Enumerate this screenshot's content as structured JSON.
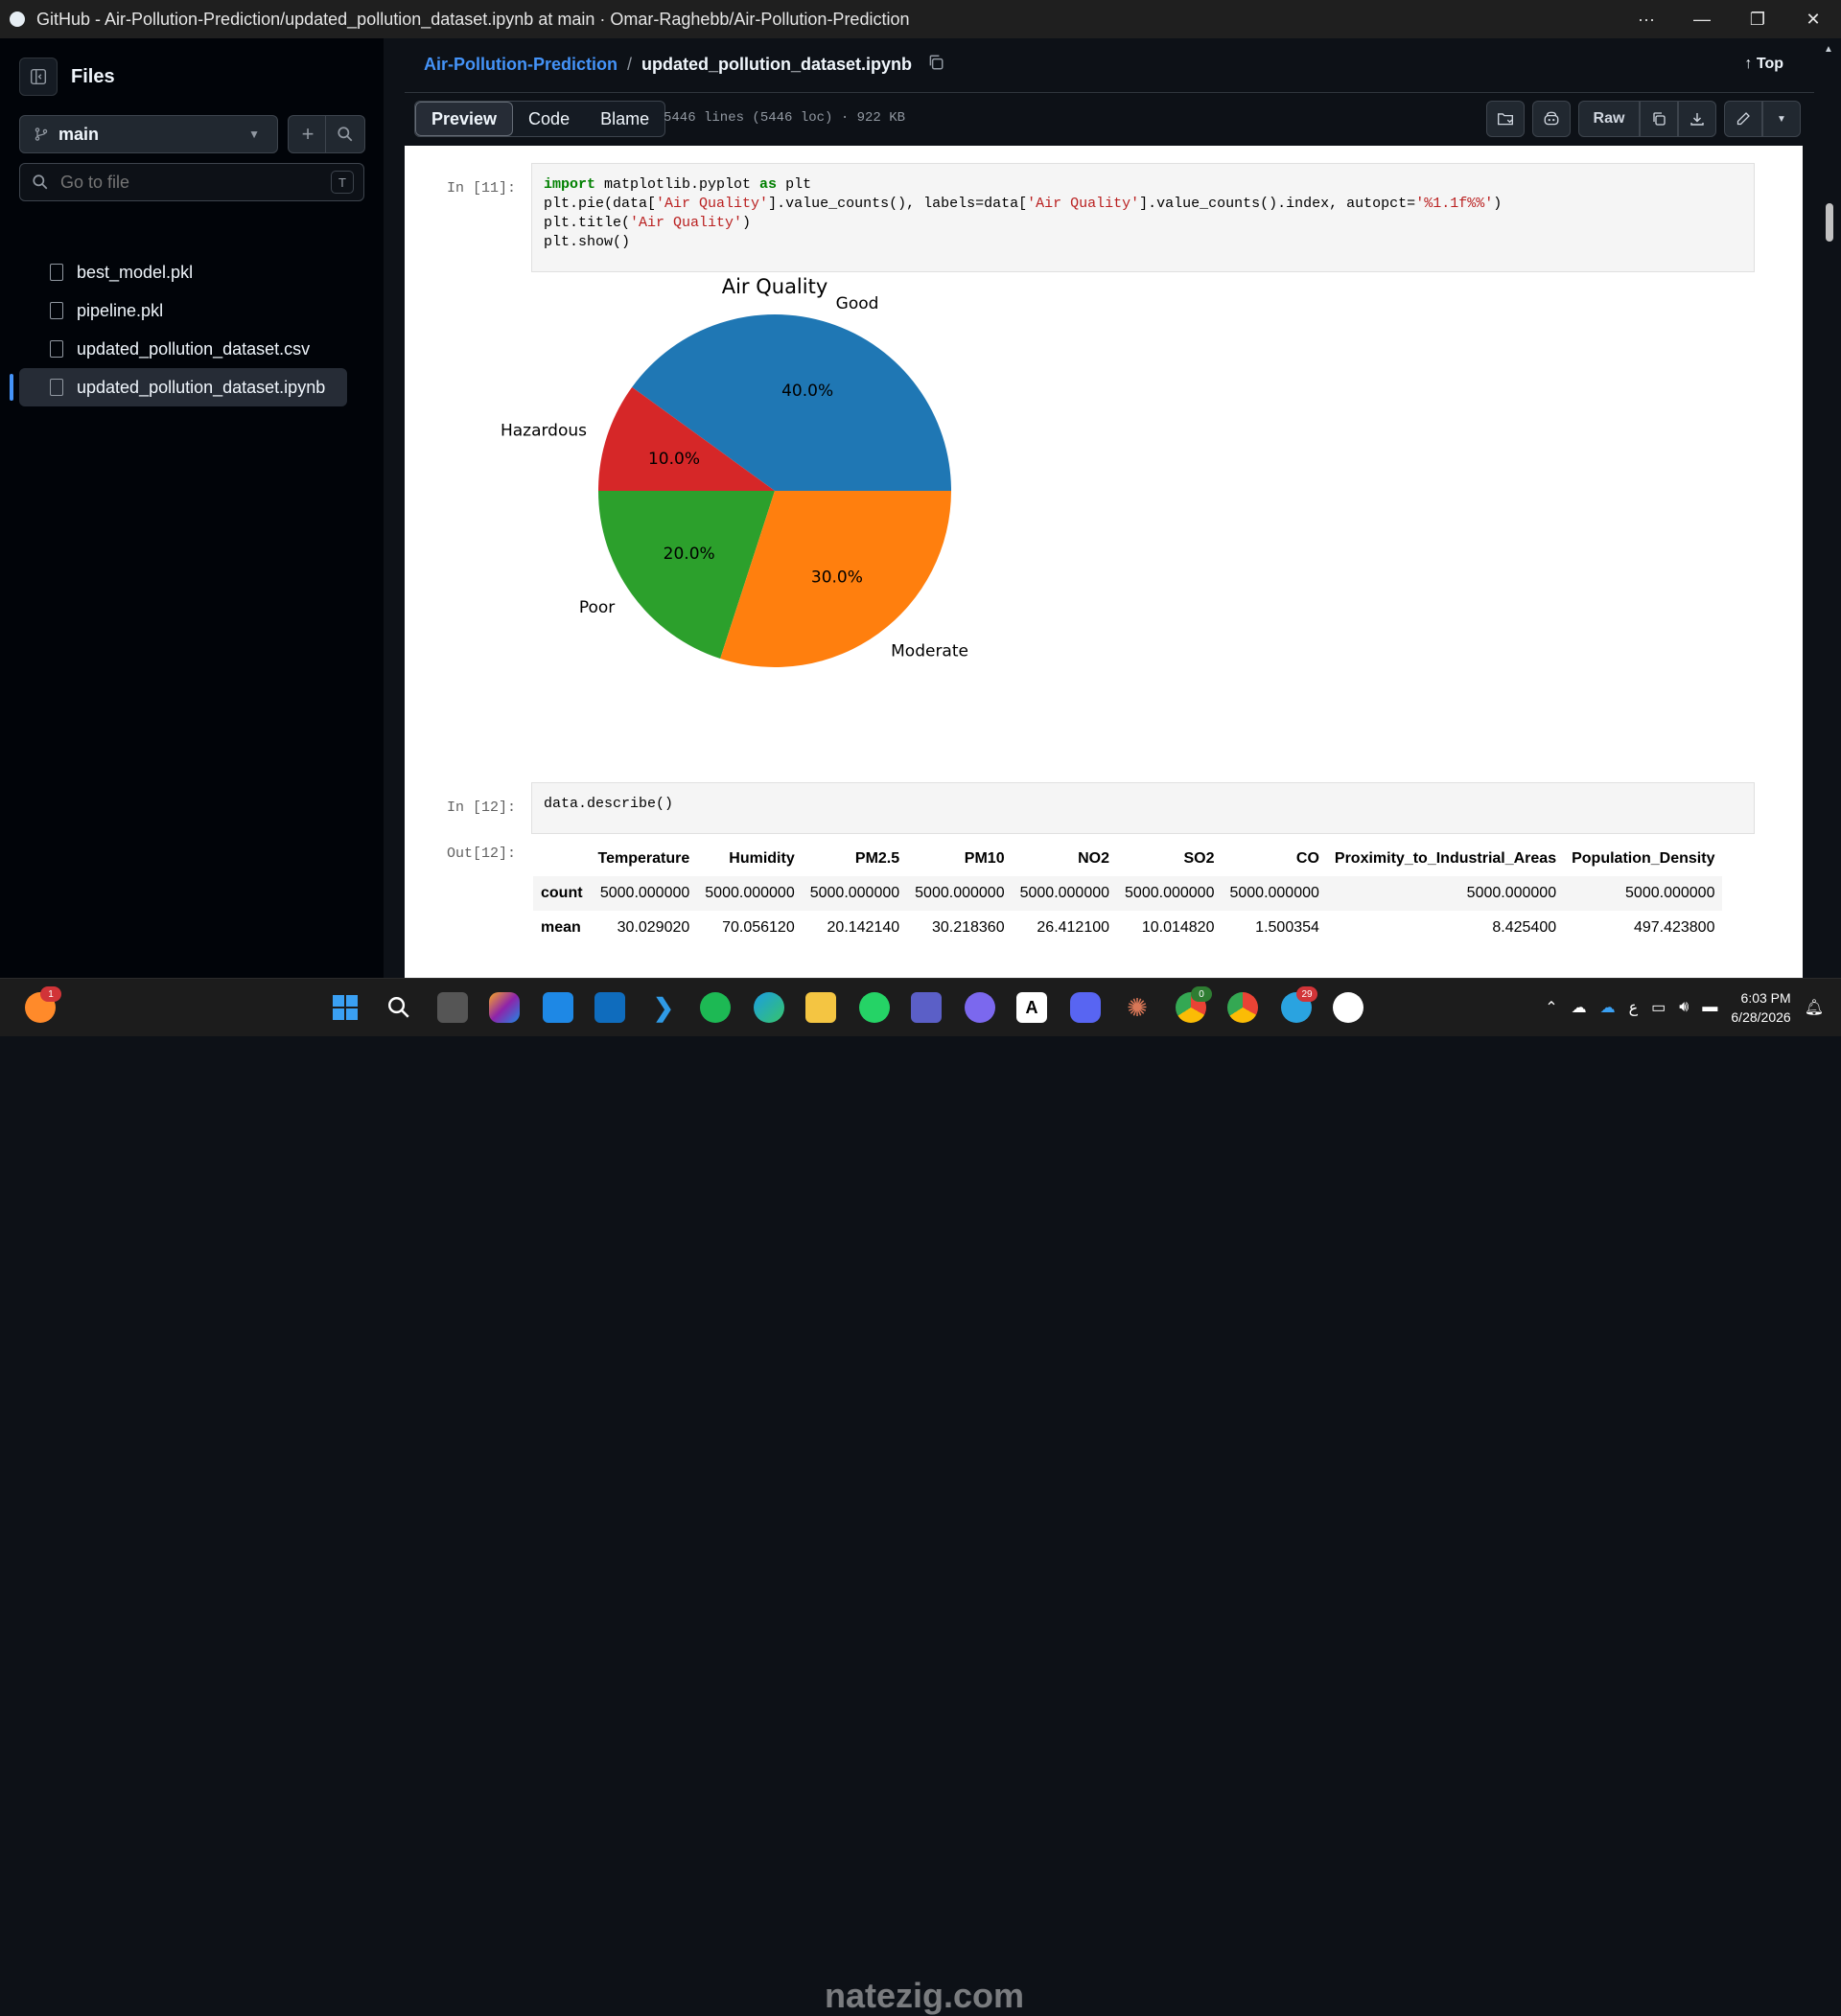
{
  "window": {
    "title": "GitHub - Air-Pollution-Prediction/updated_pollution_dataset.ipynb at main · Omar-Raghebb/Air-Pollution-Prediction",
    "more": "···",
    "minimize": "—",
    "maximize": "❐",
    "close": "✕"
  },
  "sidebar": {
    "title": "Files",
    "branch": "main",
    "add": "+",
    "search_icon": "⌕",
    "goto_placeholder": "Go to file",
    "goto_kbd": "T",
    "files": [
      {
        "name": "best_model.pkl",
        "active": false
      },
      {
        "name": "pipeline.pkl",
        "active": false
      },
      {
        "name": "updated_pollution_dataset.csv",
        "active": false
      },
      {
        "name": "updated_pollution_dataset.ipynb",
        "active": true
      }
    ]
  },
  "header": {
    "repo": "Air-Pollution-Prediction",
    "sep": "/",
    "file": "updated_pollution_dataset.ipynb",
    "top": "Top",
    "tabs": [
      "Preview",
      "Code",
      "Blame"
    ],
    "meta": "5446 lines (5446 loc) · 922 KB",
    "raw": "Raw"
  },
  "notebook": {
    "cell11": {
      "prompt": "In [11]:",
      "import_kw": "import",
      "import_mod": " matplotlib.pyplot ",
      "as_kw": "as",
      "import_alias": " plt",
      "line2_a": "plt.pie(data[",
      "line2_s1": "'Air Quality'",
      "line2_b": "].value_counts(), labels=data[",
      "line2_s2": "'Air Quality'",
      "line2_c": "].value_counts().index, autopct=",
      "line2_s3": "'%1.1f%%'",
      "line2_d": ")",
      "line3_a": "plt.title(",
      "line3_s": "'Air Quality'",
      "line3_b": ")",
      "line4": "plt.show()"
    },
    "cell12": {
      "prompt": "In [12]:",
      "code": "data.describe()",
      "out_prompt": "Out[12]:",
      "columns": [
        "",
        "Temperature",
        "Humidity",
        "PM2.5",
        "PM10",
        "NO2",
        "SO2",
        "CO",
        "Proximity_to_Industrial_Areas",
        "Population_Density"
      ],
      "rows": [
        [
          "count",
          "5000.000000",
          "5000.000000",
          "5000.000000",
          "5000.000000",
          "5000.000000",
          "5000.000000",
          "5000.000000",
          "5000.000000",
          "5000.000000"
        ],
        [
          "mean",
          "30.029020",
          "70.056120",
          "20.142140",
          "30.218360",
          "26.412100",
          "10.014820",
          "1.500354",
          "8.425400",
          "497.423800"
        ]
      ]
    }
  },
  "chart_data": {
    "type": "pie",
    "title": "Air Quality",
    "categories": [
      "Good",
      "Hazardous",
      "Poor",
      "Moderate"
    ],
    "values": [
      40.0,
      10.0,
      20.0,
      30.0
    ],
    "percent_labels": [
      "40.0%",
      "10.0%",
      "20.0%",
      "30.0%"
    ],
    "colors": [
      "#1f77b4",
      "#d62728",
      "#2ca02c",
      "#ff7f0e"
    ],
    "start": "top",
    "direction": "clockwise"
  },
  "taskbar": {
    "time": "6:03 PM",
    "date": "6/28/2026",
    "watermark": "natezig.com",
    "badges": {
      "firefox": "1",
      "chrome1": "0",
      "telegram": "29"
    }
  }
}
